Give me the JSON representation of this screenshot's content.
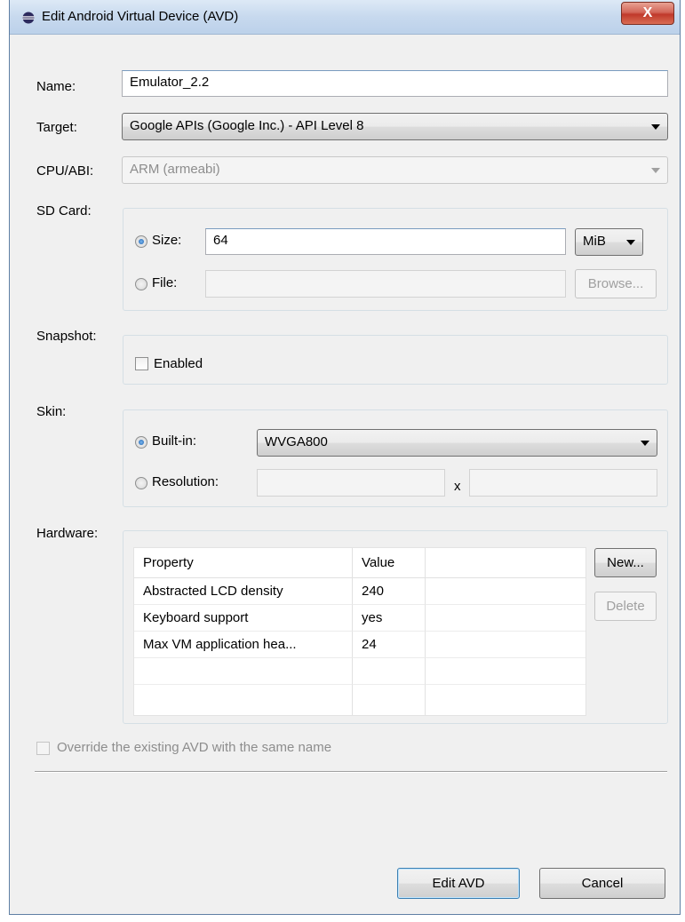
{
  "window": {
    "title": "Edit Android Virtual Device (AVD)",
    "close_label": "X"
  },
  "name": {
    "label": "Name:",
    "value": "Emulator_2.2"
  },
  "target": {
    "label": "Target:",
    "value": "Google APIs (Google Inc.) - API Level 8"
  },
  "cpu_abi": {
    "label": "CPU/ABI:",
    "value": "ARM (armeabi)"
  },
  "sd_card": {
    "label": "SD Card:",
    "size_label": "Size:",
    "size_value": "64",
    "unit": "MiB",
    "file_label": "File:",
    "file_value": "",
    "browse_label": "Browse..."
  },
  "snapshot": {
    "label": "Snapshot:",
    "enabled_label": "Enabled"
  },
  "skin": {
    "label": "Skin:",
    "builtin_label": "Built-in:",
    "builtin_value": "WVGA800",
    "resolution_label": "Resolution:",
    "x_label": "x"
  },
  "hardware": {
    "label": "Hardware:",
    "columns": [
      "Property",
      "Value"
    ],
    "rows": [
      {
        "property": "Abstracted LCD density",
        "value": "240"
      },
      {
        "property": "Keyboard support",
        "value": "yes"
      },
      {
        "property": "Max VM application hea...",
        "value": "24"
      }
    ],
    "new_label": "New...",
    "delete_label": "Delete"
  },
  "override_label": "Override the existing AVD with the same name",
  "buttons": {
    "edit_label": "Edit AVD",
    "cancel_label": "Cancel"
  },
  "colors": {
    "titlebar": "#c7d9ee",
    "close": "#c0392b",
    "dialog_bg": "#f0f0f0"
  }
}
